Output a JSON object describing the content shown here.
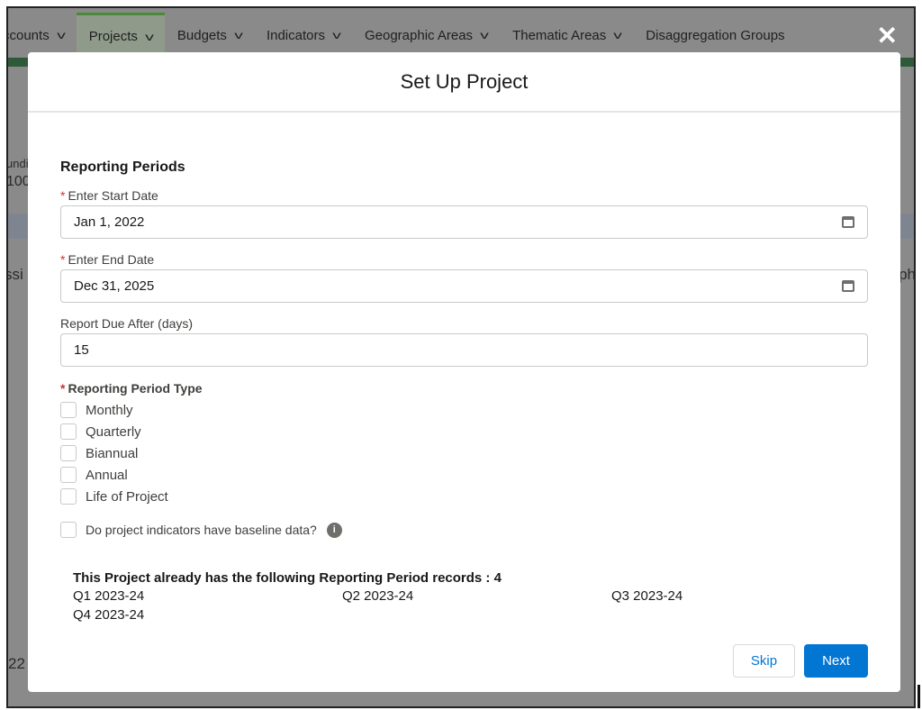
{
  "nav": {
    "items": [
      {
        "label": "ccounts"
      },
      {
        "label": "Projects",
        "active": true
      },
      {
        "label": "Budgets"
      },
      {
        "label": "Indicators"
      },
      {
        "label": "Geographic Areas"
      },
      {
        "label": "Thematic Areas"
      },
      {
        "label": "Disaggregation Groups"
      }
    ]
  },
  "background": {
    "fragments": [
      "undi",
      "100",
      "ssi",
      "22",
      "ph"
    ]
  },
  "modal": {
    "title": "Set Up Project",
    "close_icon": "close-icon",
    "section_title": "Reporting Periods",
    "start_date": {
      "label": "Enter Start Date",
      "value": "Jan 1, 2022",
      "required": true
    },
    "end_date": {
      "label": "Enter End Date",
      "value": "Dec 31, 2025",
      "required": true
    },
    "report_due": {
      "label": "Report Due After (days)",
      "value": "15"
    },
    "period_type": {
      "label": "Reporting Period Type",
      "required": true,
      "options": [
        {
          "label": "Monthly",
          "checked": false
        },
        {
          "label": "Quarterly",
          "checked": false
        },
        {
          "label": "Biannual",
          "checked": false
        },
        {
          "label": "Annual",
          "checked": false
        },
        {
          "label": "Life of Project",
          "checked": false
        }
      ]
    },
    "baseline": {
      "label": "Do project indicators have baseline data?",
      "checked": false
    },
    "records": {
      "title": "This Project already has the following Reporting Period records : 4",
      "items": [
        "Q1 2023-24",
        "Q2 2023-24",
        "Q3 2023-24",
        "Q4 2023-24"
      ]
    },
    "buttons": {
      "skip": "Skip",
      "next": "Next"
    }
  },
  "colors": {
    "brand": "#0176d3",
    "required": "#c23934"
  }
}
